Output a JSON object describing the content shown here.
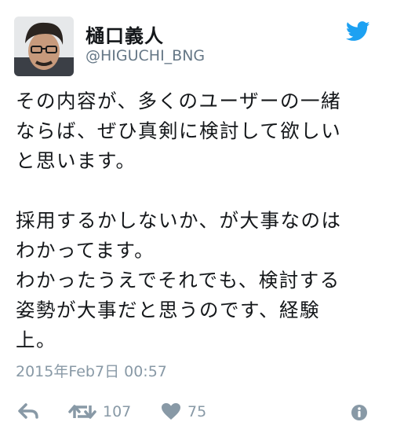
{
  "user": {
    "display_name": "樋口義人",
    "handle": "@HIGUCHI_BNG"
  },
  "tweet": {
    "lines": [
      "その内容が、多くのユーザーの一緒",
      "ならば、ぜひ真剣に検討して欲しい",
      "と思います。",
      "",
      "採用するかしないか、が大事なのは",
      "わかってます。",
      "わかったうえでそれでも、検討する",
      "姿勢が大事だと思うのです、経験",
      "上。"
    ],
    "timestamp": "2015年Feb7日 00:57"
  },
  "actions": {
    "retweet_count": "107",
    "like_count": "75"
  },
  "icons": {
    "brand": "twitter-bird-icon",
    "reply": "reply-icon",
    "retweet": "retweet-icon",
    "like": "heart-icon",
    "info": "info-icon"
  },
  "colors": {
    "twitter_blue": "#1da1f2",
    "action_gray": "#8899a6",
    "text": "#14171a"
  }
}
